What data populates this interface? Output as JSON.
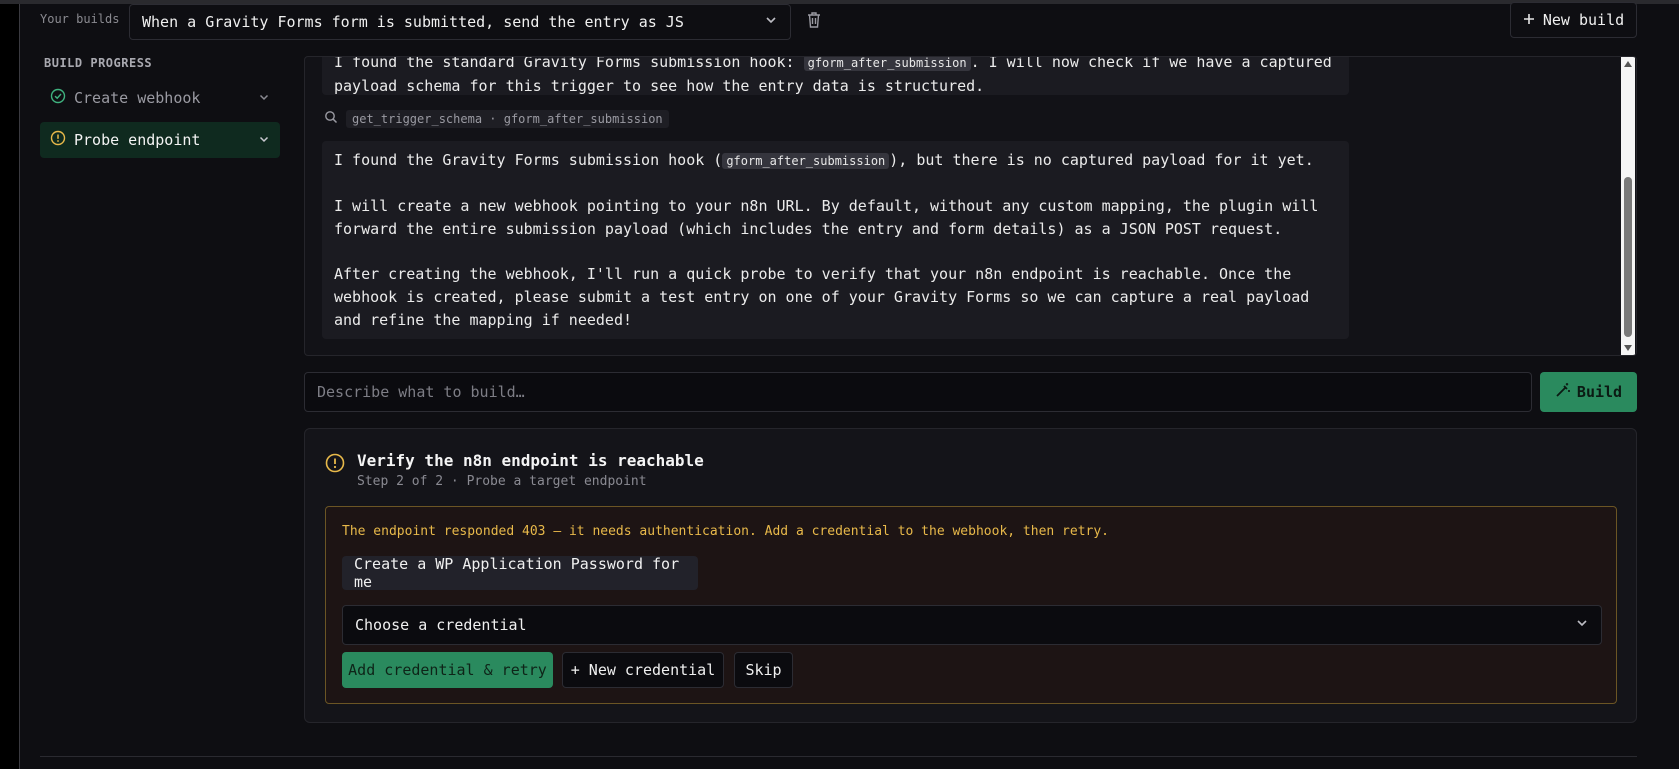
{
  "header": {
    "builds_label": "Your builds",
    "selected_build": "When a Gravity Forms form is submitted, send the entry as JS",
    "new_build_label": "New build",
    "icons": {
      "trash": "trash-icon",
      "plus": "plus-icon",
      "chevron": "chevron-down-icon"
    }
  },
  "sidebar": {
    "title": "BUILD PROGRESS",
    "items": [
      {
        "label": "Create webhook",
        "status": "done",
        "icon": "check-circle-icon"
      },
      {
        "label": "Probe endpoint",
        "status": "warning",
        "icon": "alert-circle-icon"
      }
    ]
  },
  "chat": {
    "message1": {
      "line1": "I found the standard Gravity Forms submission hook: ",
      "code": "gform_after_submission",
      "line1_rest": ". I will now check if we have a captured",
      "line2": "payload schema for this trigger to see how the entry data is structured."
    },
    "tool_call": {
      "icon": "search-icon",
      "text": "get_trigger_schema · gform_after_submission"
    },
    "message2": {
      "p1_pre": "I found the Gravity Forms submission hook (",
      "p1_code": "gform_after_submission",
      "p1_post": "), but there is no captured payload for it yet.",
      "p2": "I will create a new webhook pointing to your n8n URL. By default, without any custom mapping, the plugin will forward the entire submission payload (which includes the entry and form details) as a JSON POST request.",
      "p3": "After creating the webhook, I'll run a quick probe to verify that your n8n endpoint is reachable. Once the webhook is created, please submit a test entry on one of your Gravity Forms so we can capture a real payload and refine the mapping if needed!"
    }
  },
  "prompt": {
    "placeholder": "Describe what to build…",
    "build_label": "Build",
    "build_icon": "magic-wand-icon"
  },
  "step_card": {
    "icon": "alert-circle-icon",
    "title": "Verify the n8n endpoint is reachable",
    "subtitle": "Step 2 of 2 · Probe a target endpoint",
    "warning": "The endpoint responded 403 — it needs authentication. Add a credential to the webhook, then retry.",
    "suggestion": "Create a WP Application Password for me",
    "credential_select": "Choose a credential",
    "buttons": {
      "primary": "Add credential & retry",
      "secondary": "+ New credential",
      "skip": "Skip"
    }
  },
  "colors": {
    "accent_green": "#2a8a5e",
    "warning_amber": "#e8b94a",
    "check_green": "#3fb27f",
    "background": "#0e0e12"
  }
}
